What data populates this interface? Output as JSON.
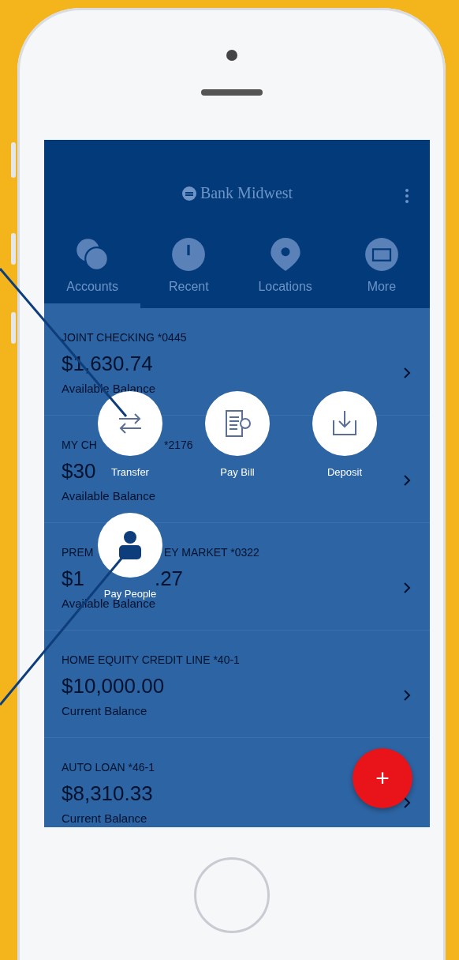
{
  "app_bar": {
    "title": "Bank Midwest"
  },
  "tabs": [
    {
      "label": "Accounts",
      "selected": true,
      "kind": "coins"
    },
    {
      "label": "Recent",
      "selected": false,
      "kind": "clock"
    },
    {
      "label": "Locations",
      "selected": false,
      "kind": "pin"
    },
    {
      "label": "More",
      "selected": false,
      "kind": "card"
    }
  ],
  "accounts": [
    {
      "name": "JOINT CHECKING *0445",
      "balance": "$1,630.74",
      "caption": "Available Balance"
    },
    {
      "name_parts": [
        "MY CH",
        "*2176"
      ],
      "balance": "$30",
      "caption": "Available Balance"
    },
    {
      "name_parts": [
        "PREM",
        "EY MARKET *0322"
      ],
      "balance_parts": [
        "$1",
        ".27"
      ],
      "caption": "Available Balance"
    },
    {
      "name": "HOME EQUITY CREDIT LINE *40-1",
      "balance": "$10,000.00",
      "caption": "Current Balance"
    },
    {
      "name": "AUTO LOAN *46-1",
      "balance": "$8,310.33",
      "caption": "Current Balance"
    }
  ],
  "actions": [
    {
      "label": "Transfer",
      "kind": "transfer"
    },
    {
      "label": "Pay Bill",
      "kind": "bill"
    },
    {
      "label": "Deposit",
      "kind": "deposit"
    },
    {
      "label": "Pay People",
      "kind": "person"
    }
  ],
  "fab": {
    "label": "+"
  }
}
